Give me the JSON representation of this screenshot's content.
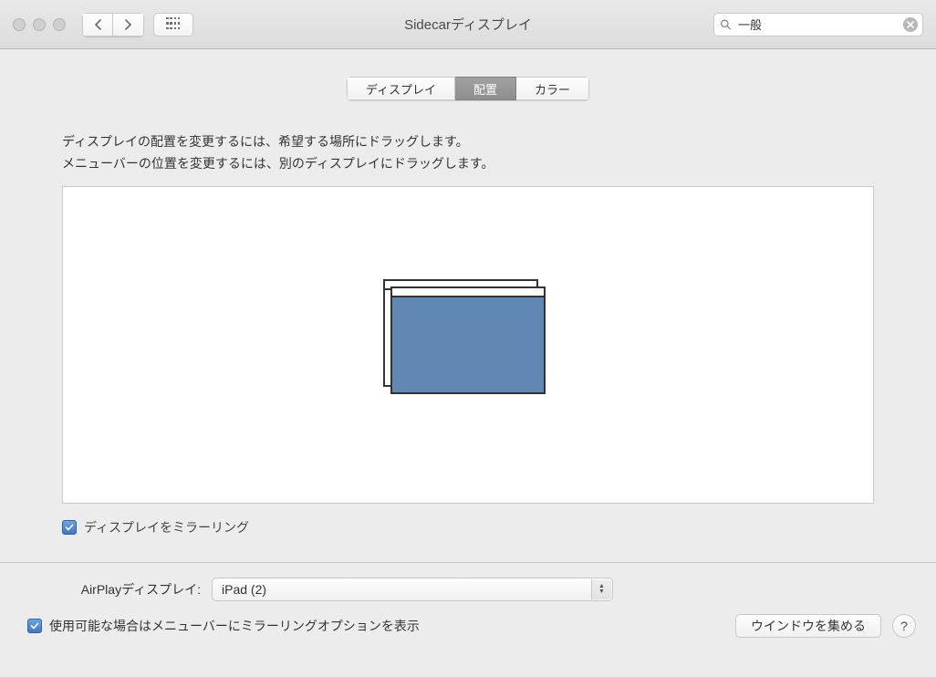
{
  "window": {
    "title": "Sidecarディスプレイ"
  },
  "search": {
    "value": "一般"
  },
  "tabs": {
    "display": "ディスプレイ",
    "arrangement": "配置",
    "color": "カラー"
  },
  "instructions": {
    "line1": "ディスプレイの配置を変更するには、希望する場所にドラッグします。",
    "line2": "メニューバーの位置を変更するには、別のディスプレイにドラッグします。"
  },
  "mirror_checkbox": {
    "label": "ディスプレイをミラーリング",
    "checked": true
  },
  "airplay": {
    "label": "AirPlayディスプレイ:",
    "selected": "iPad (2)"
  },
  "menubar_mirror_checkbox": {
    "label": "使用可能な場合はメニューバーにミラーリングオプションを表示",
    "checked": true
  },
  "gather_button": "ウインドウを集める"
}
